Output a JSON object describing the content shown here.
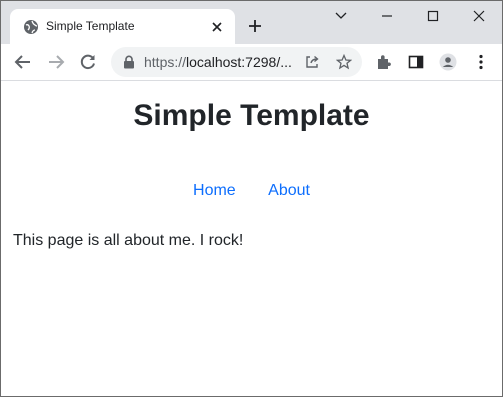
{
  "browser": {
    "tab": {
      "title": "Simple Template"
    },
    "address_bar": {
      "scheme": "https://",
      "host_path": "localhost:7298/..."
    }
  },
  "page": {
    "title": "Simple Template",
    "nav": {
      "home": "Home",
      "about": "About"
    },
    "body_text": "This page is all about me. I rock!"
  },
  "colors": {
    "link": "#0d6efd",
    "chrome_frame": "#dfe1e5",
    "omnibox_bg": "#f1f3f4"
  }
}
